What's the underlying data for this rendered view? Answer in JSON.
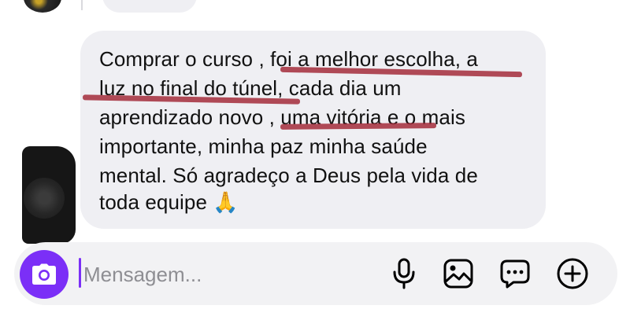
{
  "message": {
    "lines": [
      "Comprar o curso , foi a melhor escolha, a",
      "luz no final do túnel, cada dia um",
      "aprendizado novo , uma vitória e o mais",
      "importante, minha paz minha saúde",
      "mental. Só agradeço a Deus pela vida de",
      "toda equipe 🙏"
    ]
  },
  "composer": {
    "placeholder": "Mensagem...",
    "value": ""
  },
  "icons": {
    "camera": "camera-icon",
    "microphone": "microphone-icon",
    "gallery": "gallery-icon",
    "sticker": "chat-bubble-icon",
    "add": "plus-circle-icon"
  },
  "colors": {
    "accent": "#7b2ff7",
    "bubble": "#efeff3",
    "highlight": "#a32b39"
  }
}
